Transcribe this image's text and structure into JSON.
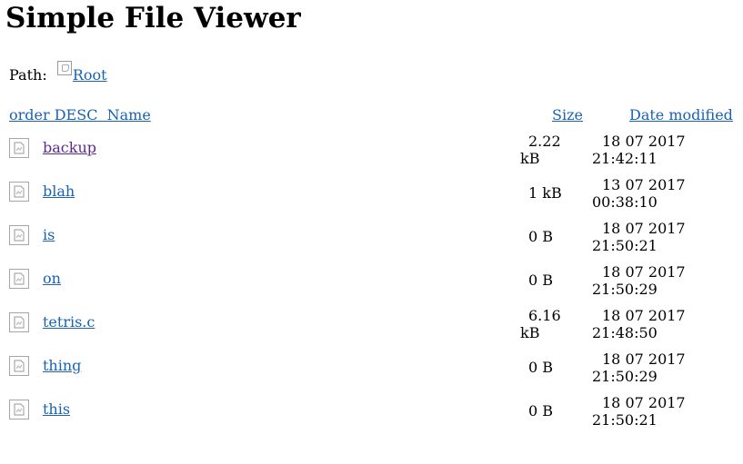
{
  "page": {
    "title": "Simple File Viewer"
  },
  "path": {
    "label": "Path:",
    "root_link": "Root",
    "root_icon": "folder-icon"
  },
  "table": {
    "headers": {
      "name": "order DESC  Name",
      "size": "Size",
      "date": "Date modified"
    },
    "rows": [
      {
        "name": "backup",
        "size": "2.22 kB",
        "date": "18 07 2017 21:42:11",
        "visited": true,
        "icon": "file-icon"
      },
      {
        "name": "blah",
        "size": "1 kB",
        "date": "13 07 2017 00:38:10",
        "visited": false,
        "icon": "file-icon"
      },
      {
        "name": "is",
        "size": "0 B",
        "date": "18 07 2017 21:50:21",
        "visited": false,
        "icon": "file-icon"
      },
      {
        "name": "on",
        "size": "0 B",
        "date": "18 07 2017 21:50:29",
        "visited": false,
        "icon": "file-icon"
      },
      {
        "name": "tetris.c",
        "size": "6.16 kB",
        "date": "18 07 2017 21:48:50",
        "visited": false,
        "icon": "file-icon"
      },
      {
        "name": "thing",
        "size": "0 B",
        "date": "18 07 2017 21:50:29",
        "visited": false,
        "icon": "file-icon"
      },
      {
        "name": "this",
        "size": "0 B",
        "date": "18 07 2017 21:50:21",
        "visited": false,
        "icon": "file-icon"
      }
    ]
  },
  "colors": {
    "link": "#1a62b4",
    "visited_link": "#5a2a8c"
  }
}
